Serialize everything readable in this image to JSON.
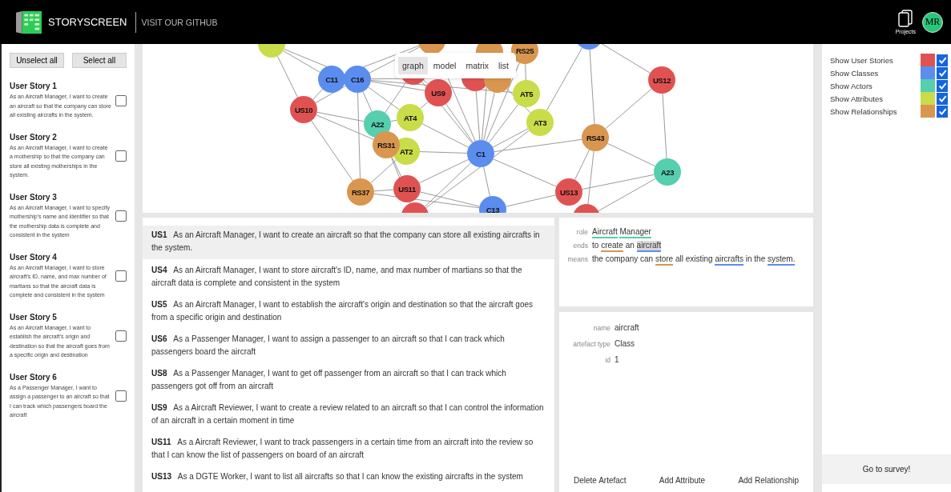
{
  "header": {
    "brand": "STORYSCREEN",
    "link": "VISIT OUR GITHUB",
    "projects_label": "Projects",
    "avatar": "MR"
  },
  "sidebar": {
    "buttons": [
      "Unselect all",
      "Select all"
    ],
    "stories": [
      {
        "title": "User Story 1",
        "text": "As an Aircraft Manager, I want to create an aircraft so that the company can store all existing aircrafts in the system.",
        "checked": false
      },
      {
        "title": "User Story 2",
        "text": "As an Aircraft Manager, I want to create a mothership so that the company can store all existing motherships in the system.",
        "checked": false
      },
      {
        "title": "User Story 3",
        "text": "As an Aircraft Manager, I want to specify mothership's name and identifier so that the mothership data is complete and consistent in the system",
        "checked": false
      },
      {
        "title": "User Story 4",
        "text": "As an Aircraft Manager, I want to store aircraft's ID, name, and max number of martians so that the aircraft data is complete and consistent in the system",
        "checked": false
      },
      {
        "title": "User Story 5",
        "text": "As an Aircraft Manager, I want to establish the aircraft's origin and destination so that the aircraft goes from a specific origin and destination",
        "checked": false
      },
      {
        "title": "User Story 6",
        "text": "As a Passenger Manager, I want to assign a passenger to an aircraft so that I can track which passengers board the aircraft",
        "checked": false
      }
    ]
  },
  "graph_tabs": [
    {
      "label": "graph",
      "selected": true
    },
    {
      "label": "model",
      "selected": false
    },
    {
      "label": "matrix",
      "selected": false
    },
    {
      "label": "list",
      "selected": false
    }
  ],
  "graph_nodes": [
    {
      "kind": "attribute"
    },
    {
      "kind": "relationship"
    },
    {
      "kind": "relationship"
    },
    {
      "kind": "relationship",
      "label": "RS25"
    },
    {
      "kind": "class"
    },
    {
      "kind": "story"
    },
    {
      "kind": "story"
    },
    {
      "kind": "relationship"
    },
    {
      "kind": "class",
      "label": "C11"
    },
    {
      "kind": "class",
      "label": "C16"
    },
    {
      "kind": "story",
      "label": "US10"
    },
    {
      "kind": "story",
      "label": "US9"
    },
    {
      "kind": "attribute",
      "label": "AT5"
    },
    {
      "kind": "story",
      "label": "US12"
    },
    {
      "kind": "actor",
      "label": "A22"
    },
    {
      "kind": "attribute",
      "label": "AT4"
    },
    {
      "kind": "attribute",
      "label": "AT3"
    },
    {
      "kind": "relationship",
      "label": "RS43"
    },
    {
      "kind": "attribute",
      "label": "AT2"
    },
    {
      "kind": "relationship",
      "label": "RS31"
    },
    {
      "kind": "class",
      "label": "C1"
    },
    {
      "kind": "actor",
      "label": "A23"
    },
    {
      "kind": "relationship",
      "label": "RS37"
    },
    {
      "kind": "story",
      "label": "US11"
    },
    {
      "kind": "story",
      "label": "US13"
    },
    {
      "kind": "class",
      "label": "C13"
    },
    {
      "kind": "story"
    },
    {
      "kind": "story"
    }
  ],
  "story_list": [
    {
      "id": "US1",
      "text": "As an Aircraft Manager, I want to create an aircraft so that the company can store all existing aircrafts in the system.",
      "selected": true
    },
    {
      "id": "US4",
      "text": "As an Aircraft Manager, I want to store aircraft's ID, name, and max number of martians so that the aircraft data is complete and consistent in the system",
      "selected": false
    },
    {
      "id": "US5",
      "text": "As an Aircraft Manager, I want to establish the aircraft's origin and destination so that the aircraft goes from a specific origin and destination",
      "selected": false
    },
    {
      "id": "US6",
      "text": "As a Passenger Manager, I want to assign a passenger to an aircraft so that I can track which passengers board the aircraft",
      "selected": false
    },
    {
      "id": "US8",
      "text": "As a Passenger Manager, I want to get off passenger from an aircraft so that I can track which passengers got off from an aircraft",
      "selected": false
    },
    {
      "id": "US9",
      "text": "As a Aircraft Reviewer, I want to create a review related to an aircraft so that I can control the information of an aircraft in a certain moment in time",
      "selected": false
    },
    {
      "id": "US11",
      "text": "As a Aircraft Reviewer, I want to track passengers in a certain time from an aircraft into the review so that I can know the list of passengers on board of an aircraft",
      "selected": false
    },
    {
      "id": "US13",
      "text": "As a DGTE Worker, I want to list all aircrafts so that I can know the existing aircrafts in the system",
      "selected": false
    }
  ],
  "story_detail": {
    "rows": [
      {
        "label": "role",
        "segments": [
          {
            "text": "Aircraft",
            "kind": "actor",
            "selected": false
          },
          {
            "text": "Manager",
            "kind": "actor",
            "selected": false
          }
        ]
      },
      {
        "label": "ends",
        "segments": [
          {
            "text": "to "
          },
          {
            "text": "create",
            "kind": "relationship",
            "selected": false
          },
          {
            "text": " an "
          },
          {
            "text": "aircraft",
            "kind": "class",
            "selected": true
          }
        ]
      },
      {
        "label": "means",
        "segments": [
          {
            "text": "the company can "
          },
          {
            "text": "store",
            "kind": "relationship",
            "selected": false
          },
          {
            "text": " all existing "
          },
          {
            "text": "aircrafts",
            "kind": "class",
            "selected": false
          },
          {
            "text": " in the "
          },
          {
            "text": "system.",
            "kind": "class",
            "selected": false
          }
        ]
      }
    ]
  },
  "artefact": {
    "fields": [
      {
        "label": "name",
        "value": "aircraft"
      },
      {
        "label": "artefact type",
        "value": "Class"
      },
      {
        "label": "id",
        "value": "1"
      }
    ],
    "buttons": [
      "Delete Artefact",
      "Add Attribute",
      "Add Relationship"
    ]
  },
  "legend": [
    {
      "kind": "story",
      "label": "Show User Stories",
      "color": "#e05252",
      "checked": true
    },
    {
      "kind": "class",
      "label": "Show Classes",
      "color": "#5b8def",
      "checked": true
    },
    {
      "kind": "actor",
      "label": "Show Actors",
      "color": "#55cfae",
      "checked": true
    },
    {
      "kind": "attribute",
      "label": "Show Attributes",
      "color": "#c9dc4a",
      "checked": true
    },
    {
      "kind": "relationship",
      "label": "Show Relationships",
      "color": "#d9964f",
      "checked": true
    }
  ],
  "survey_button": "Go to survey!"
}
